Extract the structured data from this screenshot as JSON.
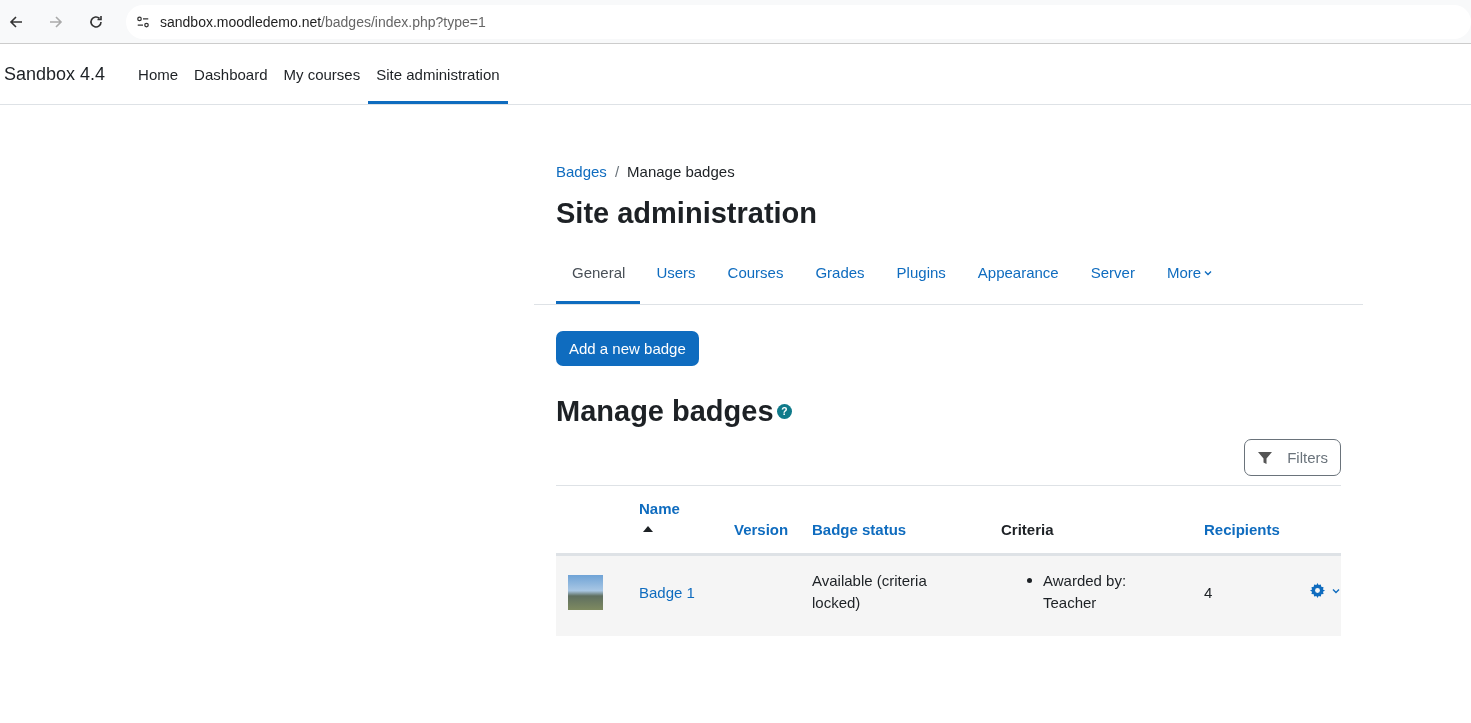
{
  "browser": {
    "url_host": "sandbox.moodledemo.net",
    "url_path": "/badges/index.php?type=1"
  },
  "navbar": {
    "brand": "Sandbox 4.4",
    "items": [
      {
        "label": "Home",
        "selected": false
      },
      {
        "label": "Dashboard",
        "selected": false
      },
      {
        "label": "My courses",
        "selected": false
      },
      {
        "label": "Site administration",
        "selected": true
      }
    ]
  },
  "breadcrumb_separator": "/",
  "breadcrumb": [
    {
      "label": "Badges",
      "link": true
    },
    {
      "label": "Manage badges",
      "link": false
    }
  ],
  "page_title": "Site administration",
  "tabs": [
    {
      "label": "General",
      "selected": true,
      "dropdown": false
    },
    {
      "label": "Users",
      "selected": false,
      "dropdown": false
    },
    {
      "label": "Courses",
      "selected": false,
      "dropdown": false
    },
    {
      "label": "Grades",
      "selected": false,
      "dropdown": false
    },
    {
      "label": "Plugins",
      "selected": false,
      "dropdown": false
    },
    {
      "label": "Appearance",
      "selected": false,
      "dropdown": false
    },
    {
      "label": "Server",
      "selected": false,
      "dropdown": false
    },
    {
      "label": "More",
      "selected": false,
      "dropdown": true
    }
  ],
  "add_button": "Add a new badge",
  "section_title": "Manage badges",
  "help_icon": "?",
  "filters_button": "Filters",
  "table": {
    "columns": [
      {
        "label": "Name",
        "sortable": true,
        "sorted": true
      },
      {
        "label": "Version",
        "sortable": true,
        "sorted": false
      },
      {
        "label": "Badge status",
        "sortable": true,
        "sorted": false
      },
      {
        "label": "Criteria",
        "sortable": false,
        "sorted": false
      },
      {
        "label": "Recipients",
        "sortable": true,
        "sorted": false
      }
    ],
    "rows": [
      {
        "name": "Badge 1",
        "status": "Available (criteria locked)",
        "criteria": [
          "Awarded by: Teacher"
        ],
        "recipients": "4"
      }
    ]
  }
}
